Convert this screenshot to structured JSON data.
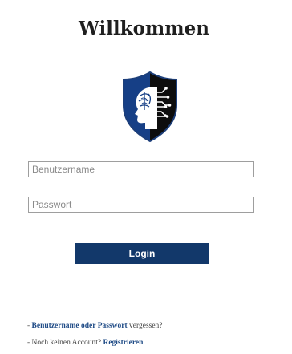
{
  "header": {
    "title": "Willkommen"
  },
  "logo": {
    "icon": "shield-brain-circuit-icon",
    "colors": {
      "blue": "#163f86",
      "dark": "#0d0d0d",
      "outline": "#1d3f7a"
    }
  },
  "form": {
    "username_placeholder": "Benutzername",
    "username_value": "",
    "password_placeholder": "Passwort",
    "password_value": "",
    "login_label": "Login"
  },
  "links": {
    "forgot": {
      "prefix": "- ",
      "link_text": "Benutzername oder Passwort",
      "suffix": " vergessen?"
    },
    "register": {
      "prefix": "- Noch keinen Account? ",
      "link_text": "Registrieren"
    }
  },
  "colors": {
    "button": "#12386a",
    "link": "#1f4b86"
  }
}
